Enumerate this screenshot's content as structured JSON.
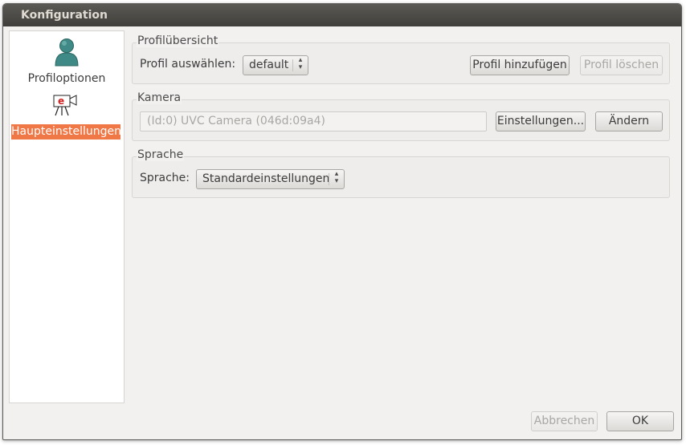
{
  "window": {
    "title": "Konfiguration"
  },
  "sidebar": {
    "items": [
      {
        "label": "Profiloptionen",
        "icon": "user-profile-icon",
        "selected": false
      },
      {
        "label": "Haupteinstellungen",
        "icon": "camera-settings-icon",
        "selected": true
      }
    ]
  },
  "profile_group": {
    "title": "Profilübersicht",
    "select_label": "Profil auswählen:",
    "select_value": "default",
    "add_button": "Profil hinzufügen",
    "delete_button": "Profil löschen"
  },
  "camera_group": {
    "title": "Kamera",
    "device_value": "(Id:0) UVC Camera (046d:09a4)",
    "settings_button": "Einstellungen...",
    "change_button": "Ändern"
  },
  "language_group": {
    "title": "Sprache",
    "label": "Sprache:",
    "value": "Standardeinstellungen"
  },
  "footer": {
    "cancel_button": "Abbrechen",
    "ok_button": "OK"
  },
  "colors": {
    "selection": "#f07746",
    "titlebar": "#403f3b"
  }
}
